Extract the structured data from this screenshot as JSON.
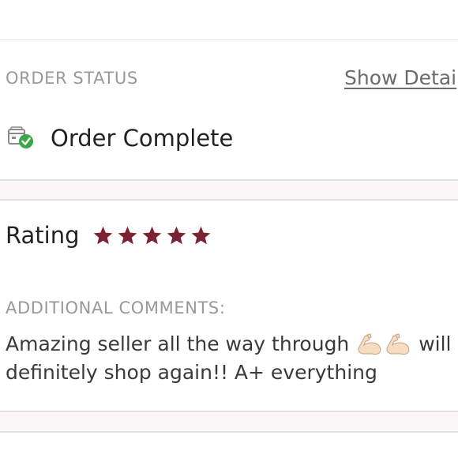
{
  "order_status": {
    "section_label": "ORDER STATUS",
    "show_details_label": "Show Detai",
    "status_text": "Order Complete",
    "status_icon": "box-check-icon"
  },
  "rating": {
    "label": "Rating",
    "stars": 5,
    "max_stars": 5,
    "star_color": "#7c2231"
  },
  "comments": {
    "section_label": "ADDITIONAL COMMENTS:",
    "text_part1": "Amazing seller all the way through",
    "text_part2": "will definitely shop again!! A+ everything",
    "emoji": "flexed-biceps"
  },
  "colors": {
    "accent_star": "#7c2231",
    "status_check": "#3aa845"
  }
}
